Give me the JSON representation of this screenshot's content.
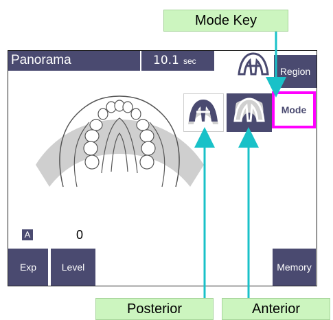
{
  "callouts": {
    "mode_key": "Mode Key",
    "posterior": "Posterior",
    "anterior": "Anterior"
  },
  "screen": {
    "mode_title": "Panorama",
    "time_value": "10.1",
    "time_unit": "sec",
    "region_label": "Region",
    "mode_label": "Mode",
    "auto_badge": "A",
    "level_value": "0",
    "exp_label": "Exp",
    "level_label": "Level",
    "memory_label": "Memory"
  },
  "icons": {
    "region": "panoramic-jaw-icon",
    "posterior": "posterior-mode-icon",
    "anterior": "anterior-mode-icon"
  },
  "colors": {
    "panel": "#4a4a70",
    "highlight": "#ff00ff",
    "callout": "#ccf5bf",
    "leader": "#19c1c8"
  }
}
